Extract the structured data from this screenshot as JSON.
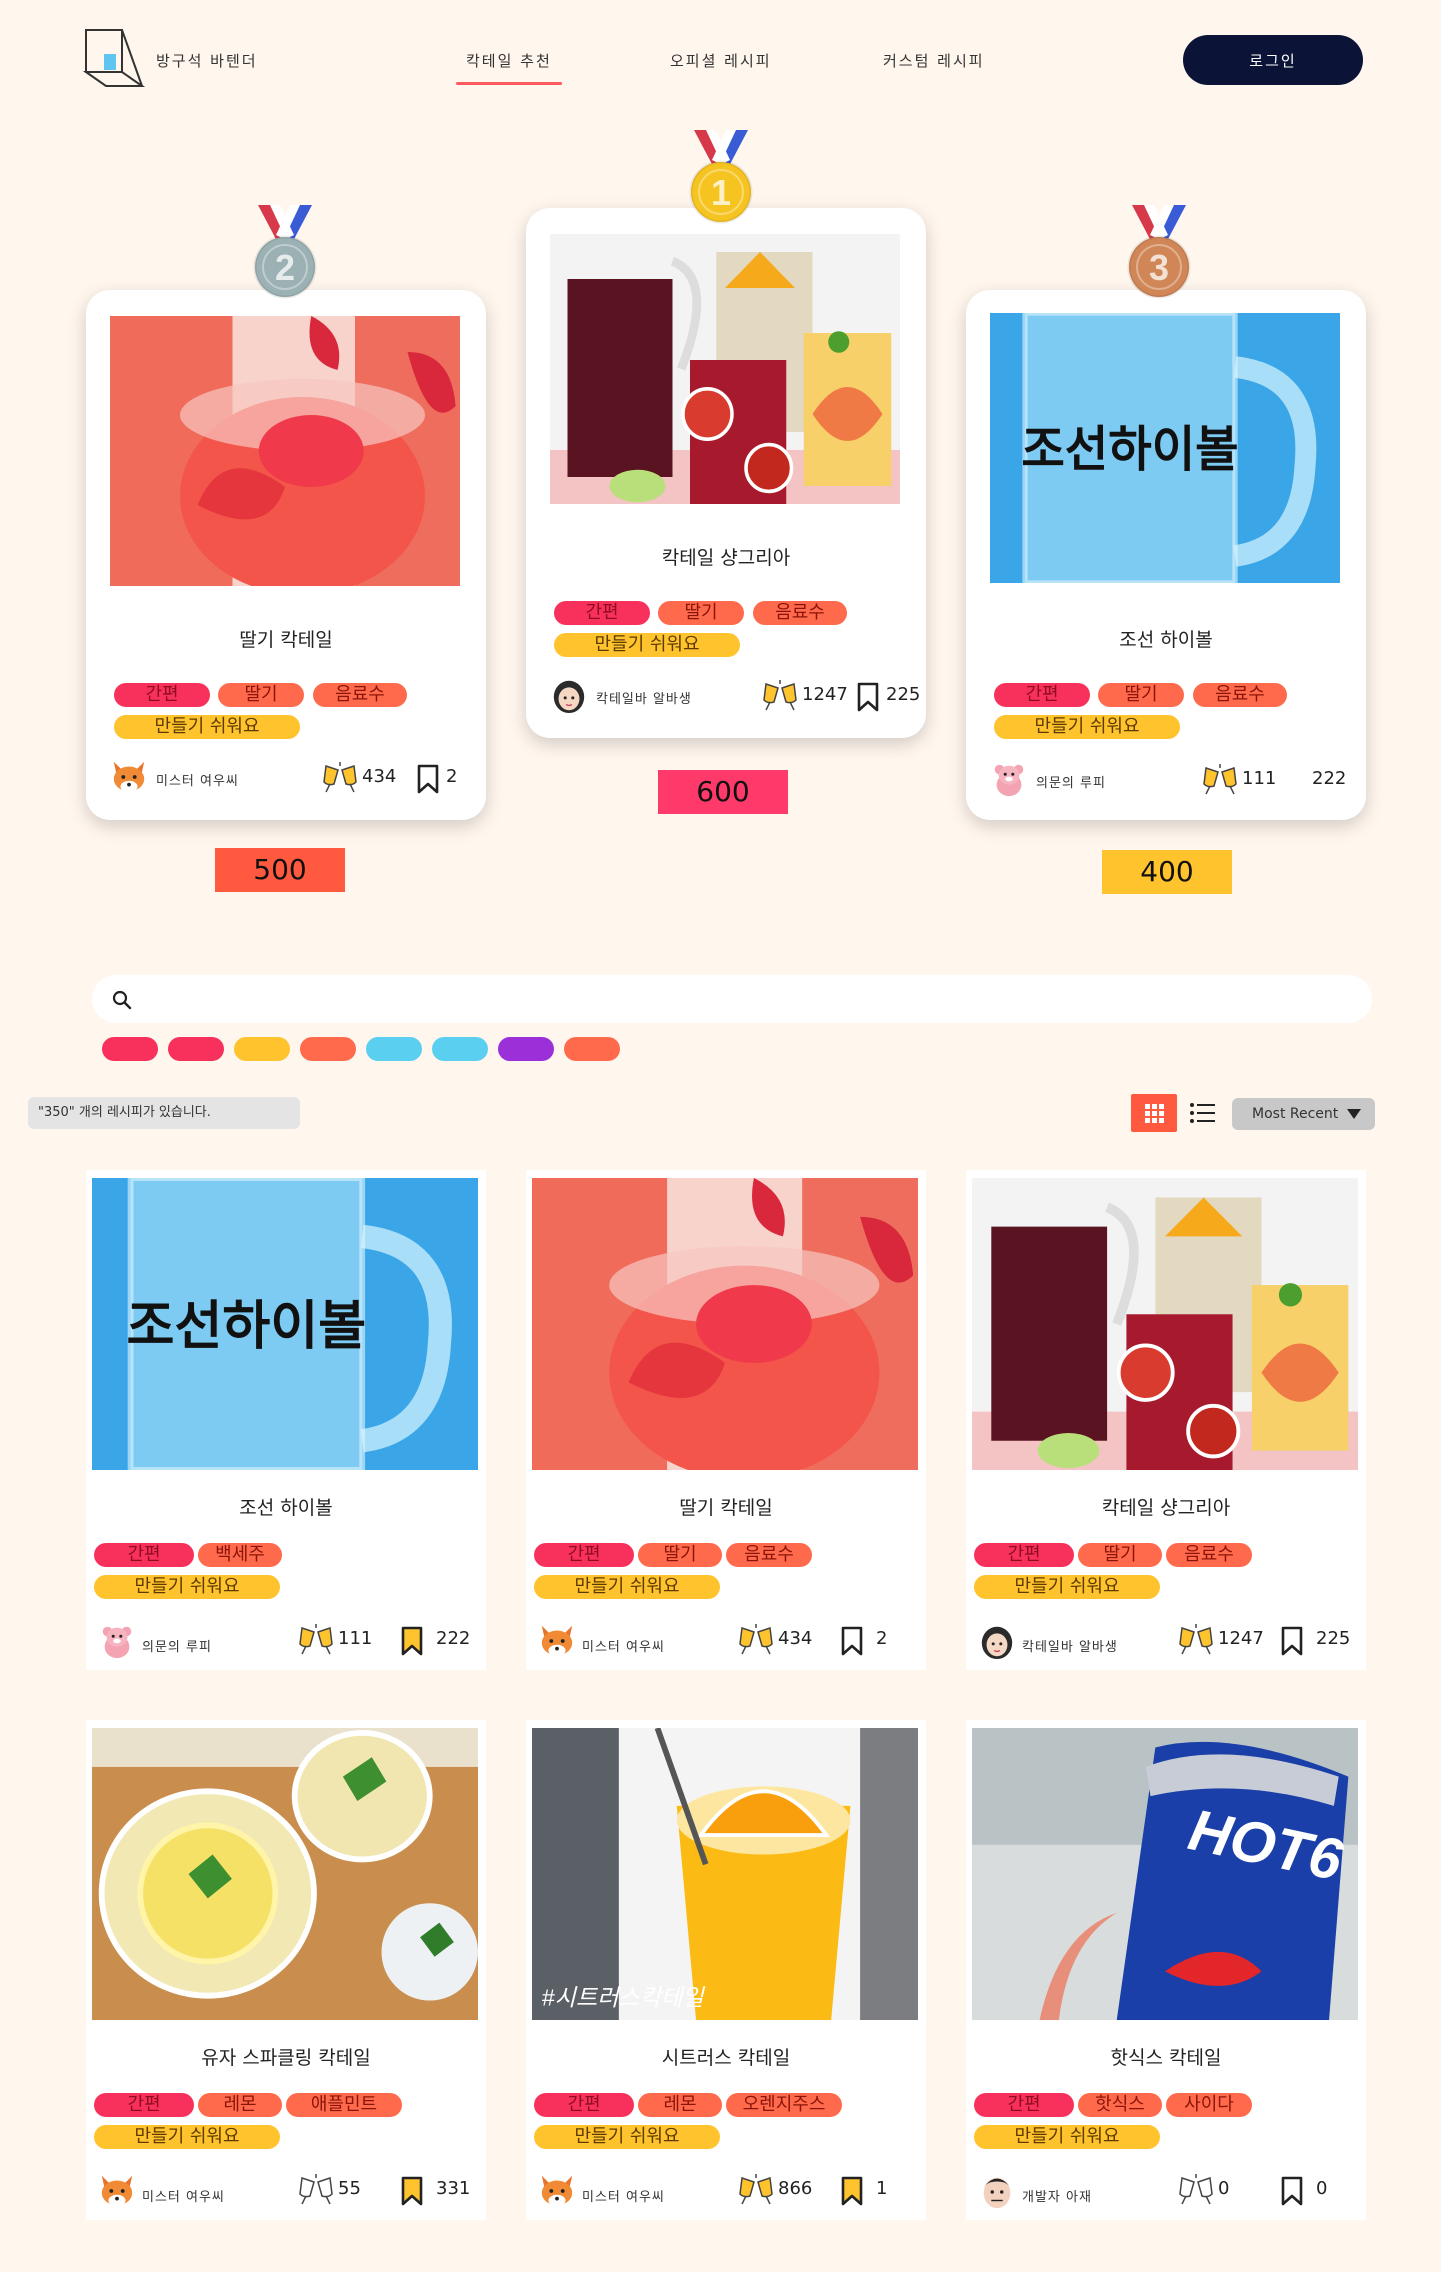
{
  "header": {
    "brand": "방구석 바텐더",
    "nav": [
      {
        "label": "칵테일 추천"
      },
      {
        "label": "오피셜 레시피"
      },
      {
        "label": "커스텀 레시피"
      }
    ],
    "login": "로그인",
    "accent": "#ff5a5f"
  },
  "podium": [
    {
      "rank": "2",
      "name": "딸기 칵테일",
      "tags": [
        "간편",
        "딸기",
        "음료수"
      ],
      "difficulty": "만들기 쉬워요",
      "author": "미스터 여우씨",
      "likes": "434",
      "bookmarks": "2",
      "score": "500",
      "medal_color": "#9bb1b4"
    },
    {
      "rank": "1",
      "name": "칵테일 샹그리아",
      "tags": [
        "간편",
        "딸기",
        "음료수"
      ],
      "difficulty": "만들기 쉬워요",
      "author": "칵테일바 알바생",
      "likes": "1247",
      "bookmarks": "225",
      "score": "600",
      "medal_color": "#f6c421"
    },
    {
      "rank": "3",
      "name": "조선 하이볼",
      "tags": [
        "간편",
        "딸기",
        "음료수"
      ],
      "difficulty": "만들기 쉬워요",
      "author": "의문의 루피",
      "likes": "111",
      "bookmarks": "222",
      "score": "400",
      "medal_color": "#d08656"
    }
  ],
  "search": {
    "placeholder": ""
  },
  "filter_chip_colors": [
    "#f8315c",
    "#f8315c",
    "#ffc32d",
    "#ff6a4d",
    "#5bcff0",
    "#5bcff0",
    "#9b30d9",
    "#ff6a4d"
  ],
  "result_count": "\"350\" 개의 레시피가 있습니다.",
  "sort": {
    "selected": "Most Recent"
  },
  "grid": [
    {
      "name": "조선 하이볼",
      "tags": [
        "간편",
        "백세주"
      ],
      "difficulty": "만들기 쉬워요",
      "author": "의문의 루피",
      "likes": "111",
      "bookmarks": "222",
      "photo": "highball",
      "avatar": "pink"
    },
    {
      "name": "딸기 칵테일",
      "tags": [
        "간편",
        "딸기",
        "음료수"
      ],
      "difficulty": "만들기 쉬워요",
      "author": "미스터 여우씨",
      "likes": "434",
      "bookmarks": "2",
      "photo": "strawberry",
      "avatar": "fox"
    },
    {
      "name": "칵테일 샹그리아",
      "tags": [
        "간편",
        "딸기",
        "음료수"
      ],
      "difficulty": "만들기 쉬워요",
      "author": "칵테일바 알바생",
      "likes": "1247",
      "bookmarks": "225",
      "photo": "sangria",
      "avatar": "girl"
    },
    {
      "name": "유자 스파클링 칵테일",
      "tags": [
        "간편",
        "레몬",
        "애플민트"
      ],
      "difficulty": "만들기 쉬워요",
      "author": "미스터 여우씨",
      "likes": "55",
      "bookmarks": "331",
      "photo": "yuzu",
      "avatar": "fox"
    },
    {
      "name": "시트러스 칵테일",
      "tags": [
        "간편",
        "레몬",
        "오렌지주스"
      ],
      "difficulty": "만들기 쉬워요",
      "author": "미스터 여우씨",
      "likes": "866",
      "bookmarks": "1",
      "photo": "citrus",
      "photo_caption": "#시트러스칵테일",
      "avatar": "fox"
    },
    {
      "name": "핫식스 칵테일",
      "tags": [
        "간편",
        "핫식스",
        "사이다"
      ],
      "difficulty": "만들기 쉬워요",
      "author": "개발자 아재",
      "likes": "0",
      "bookmarks": "0",
      "photo": "hotsix",
      "photo_caption": "HOT6",
      "avatar": "man"
    }
  ]
}
